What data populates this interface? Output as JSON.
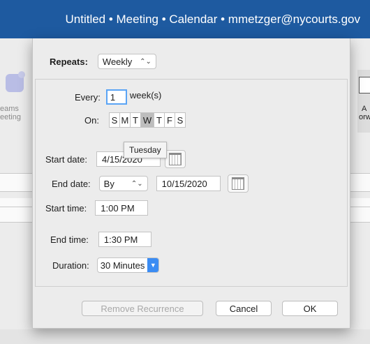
{
  "window": {
    "title": "Untitled • Meeting • Calendar • mmetzger@nycourts.gov"
  },
  "background": {
    "left_label_1": "eams",
    "left_label_2": "eeting",
    "right_label_1": "A",
    "right_label_2": "orw"
  },
  "dialog": {
    "repeats_label": "Repeats:",
    "repeats_value": "Weekly",
    "every_label": "Every:",
    "every_value": "1",
    "every_unit": "week(s)",
    "on_label": "On:",
    "days": [
      "S",
      "M",
      "T",
      "W",
      "T",
      "F",
      "S"
    ],
    "selected_day_index": 3,
    "tooltip": "Tuesday",
    "start_date_label": "Start date:",
    "start_date_value": "4/15/2020",
    "end_date_label": "End date:",
    "end_date_mode": "By",
    "end_date_value": "10/15/2020",
    "start_time_label": "Start time:",
    "start_time_value": "1:00 PM",
    "end_time_label": "End time:",
    "end_time_value": "1:30 PM",
    "duration_label": "Duration:",
    "duration_value": "30 Minutes",
    "buttons": {
      "remove": "Remove Recurrence",
      "cancel": "Cancel",
      "ok": "OK"
    }
  },
  "colors": {
    "titlebar": "#1e5aa0",
    "accent": "#3b8cf3"
  }
}
